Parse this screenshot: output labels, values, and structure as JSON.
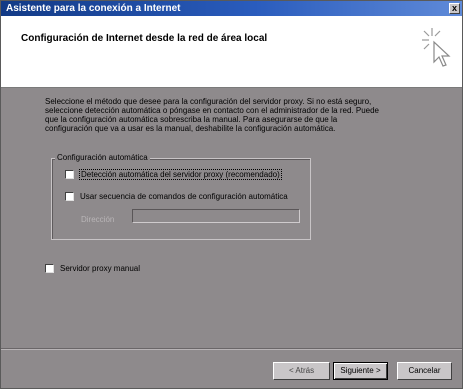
{
  "window": {
    "title": "Asistente para la conexión a Internet",
    "close_glyph": "x"
  },
  "header": {
    "title": "Configuración de Internet desde la red de área local",
    "icon": "wizard-cursor-icon"
  },
  "description": "Seleccione el método que desee para la configuración del servidor proxy. Si no está seguro, seleccione detección automática o póngase en contacto con el administrador de la red. Puede que la configuración automática sobrescriba la manual. Para asegurarse de que la configuración que va a usar es la manual, deshabilite la configuración automática.",
  "auto_config": {
    "legend": "Configuración automática",
    "auto_detect_label": "Detección automática del servidor proxy (recomendado)",
    "auto_detect_checked": false,
    "script_label": "Usar secuencia de comandos de configuración automática",
    "script_checked": false,
    "address_label": "Dirección",
    "address_value": ""
  },
  "manual_proxy": {
    "label": "Servidor proxy manual",
    "checked": false
  },
  "buttons": {
    "back": "< Atrás",
    "next": "Siguiente >",
    "cancel": "Cancelar"
  }
}
